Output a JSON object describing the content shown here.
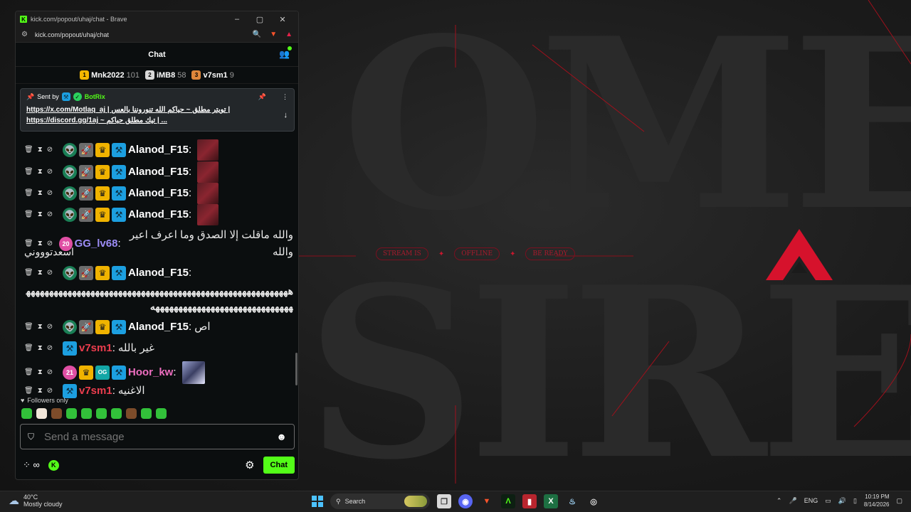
{
  "browser": {
    "window_title": "kick.com/popout/uhaj/chat - Brave",
    "url": "kick.com/popout/uhaj/chat"
  },
  "chat": {
    "title": "Chat",
    "leaderboard": [
      {
        "rank": "1",
        "name": "Mnk2022",
        "points": "101"
      },
      {
        "rank": "2",
        "name": "iMB8",
        "points": "58"
      },
      {
        "rank": "3",
        "name": "v7sm1",
        "points": "9"
      }
    ],
    "pinned": {
      "sent_by_label": "Sent by",
      "bot_name": "BotRix",
      "line1": "https://x.com/Motlaq_aj | تويتر مطلق ~ حياكم الله تنوروننا بالعس |",
      "line2": "https://discord.gg/1aj ~ تيك مطلق حياكم | ..."
    },
    "messages": [
      {
        "user": "Alanod_F15",
        "separator": ":",
        "text": ""
      },
      {
        "user": "Alanod_F15",
        "separator": ":",
        "text": ""
      },
      {
        "user": "Alanod_F15",
        "separator": ":",
        "text": ""
      },
      {
        "user": "Alanod_F15",
        "separator": ":",
        "text": ""
      },
      {
        "user": "GG_lv68",
        "separator": ":",
        "sub": "20",
        "text": "والله ماقلت إلا الصدق وما اعرف اعير والله",
        "text2": "اسعدتوووني"
      },
      {
        "user": "Alanod_F15",
        "separator": ":",
        "text": "ههههههههههههههههههههههههههههههههههههههههههههههههههههههههههههههههههههههههههههههههههههههههه"
      },
      {
        "user": "Alanod_F15",
        "separator": ":",
        "text": "اص"
      },
      {
        "user": "v7sm1",
        "separator": ":",
        "text": "غير بالله"
      },
      {
        "user": "Hoor_kw",
        "separator": ":",
        "sub": "21",
        "og": "OG",
        "text": ""
      },
      {
        "user": "v7sm1",
        "separator": ":",
        "text": "الاغنيه"
      }
    ],
    "followers_only": "Followers only",
    "input_placeholder": "Send a message",
    "send_button": "Chat",
    "infinity": "∞"
  },
  "background": {
    "pills": [
      "STREAM IS",
      "OFFLINE",
      "BE READY"
    ],
    "words": [
      "OMET",
      "SIRE"
    ],
    "accent": "#c8182e"
  },
  "taskbar": {
    "temperature": "40°C",
    "weather": "Mostly cloudy",
    "search_label": "Search",
    "language": "ENG",
    "time": "10:19 PM",
    "date": "8/14/2026"
  }
}
